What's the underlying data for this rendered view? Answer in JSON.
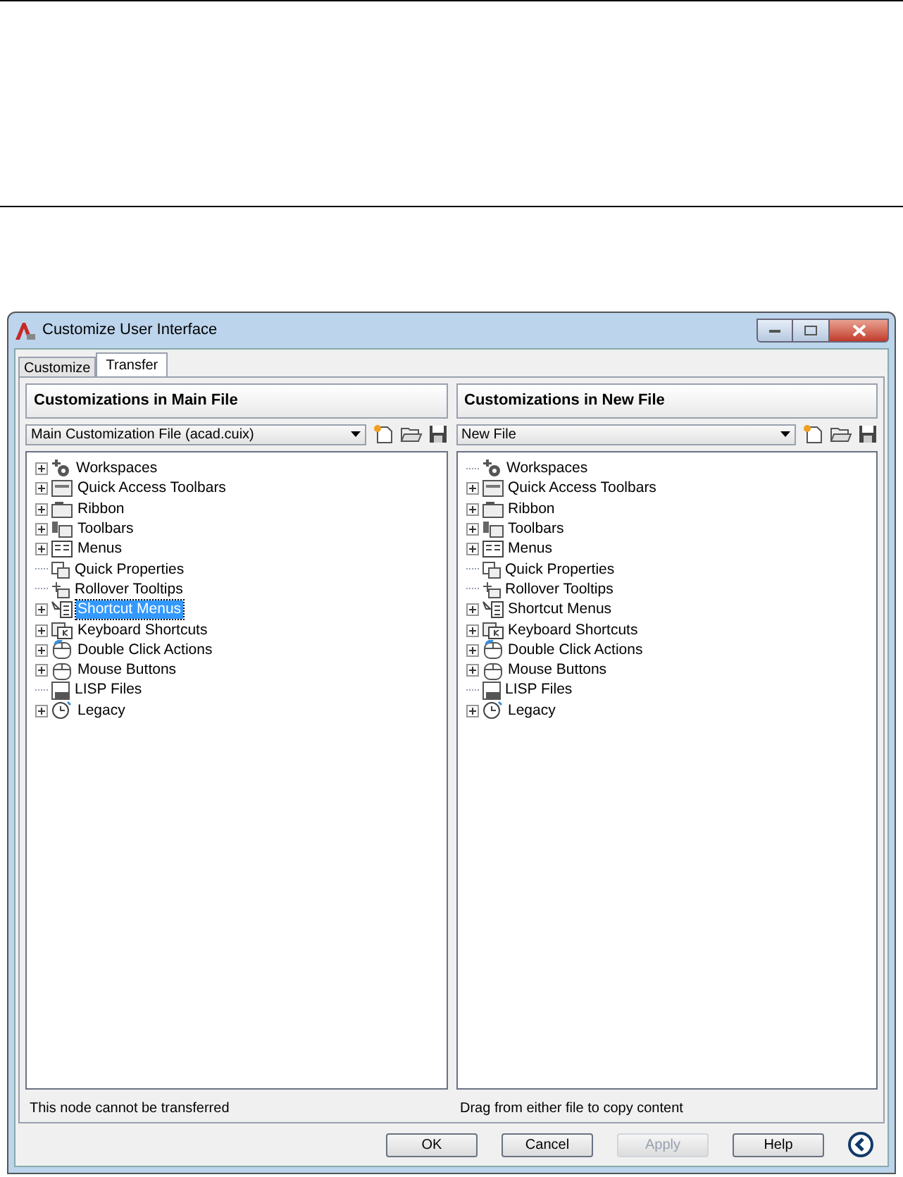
{
  "window": {
    "title": "Customize User Interface"
  },
  "tabs": [
    {
      "label": "Customize",
      "selected": false
    },
    {
      "label": "Transfer",
      "selected": true
    }
  ],
  "panes": [
    {
      "heading": "Customizations in Main File",
      "file": "Main Customization File (acad.cuix)",
      "items": [
        {
          "label": "Workspaces",
          "expandable": true,
          "selected": false
        },
        {
          "label": "Quick Access Toolbars",
          "expandable": true,
          "selected": false
        },
        {
          "label": "Ribbon",
          "expandable": true,
          "selected": false
        },
        {
          "label": "Toolbars",
          "expandable": true,
          "selected": false
        },
        {
          "label": "Menus",
          "expandable": true,
          "selected": false
        },
        {
          "label": "Quick Properties",
          "expandable": false,
          "selected": false
        },
        {
          "label": "Rollover Tooltips",
          "expandable": false,
          "selected": false
        },
        {
          "label": "Shortcut Menus",
          "expandable": true,
          "selected": true
        },
        {
          "label": "Keyboard Shortcuts",
          "expandable": true,
          "selected": false
        },
        {
          "label": "Double Click Actions",
          "expandable": true,
          "selected": false
        },
        {
          "label": "Mouse Buttons",
          "expandable": true,
          "selected": false
        },
        {
          "label": "LISP Files",
          "expandable": false,
          "selected": false
        },
        {
          "label": "Legacy",
          "expandable": true,
          "selected": false
        }
      ],
      "status": "This node cannot be transferred"
    },
    {
      "heading": "Customizations in New File",
      "file": "New File",
      "items": [
        {
          "label": "Workspaces",
          "expandable": false,
          "selected": false
        },
        {
          "label": "Quick Access Toolbars",
          "expandable": true,
          "selected": false
        },
        {
          "label": "Ribbon",
          "expandable": true,
          "selected": false
        },
        {
          "label": "Toolbars",
          "expandable": true,
          "selected": false
        },
        {
          "label": "Menus",
          "expandable": true,
          "selected": false
        },
        {
          "label": "Quick Properties",
          "expandable": false,
          "selected": false
        },
        {
          "label": "Rollover Tooltips",
          "expandable": false,
          "selected": false
        },
        {
          "label": "Shortcut Menus",
          "expandable": true,
          "selected": false
        },
        {
          "label": "Keyboard Shortcuts",
          "expandable": true,
          "selected": false
        },
        {
          "label": "Double Click Actions",
          "expandable": true,
          "selected": false
        },
        {
          "label": "Mouse Buttons",
          "expandable": true,
          "selected": false
        },
        {
          "label": "LISP Files",
          "expandable": false,
          "selected": false
        },
        {
          "label": "Legacy",
          "expandable": true,
          "selected": false
        }
      ],
      "status": "Drag from either file to copy content"
    }
  ],
  "buttons": [
    {
      "label": "OK",
      "disabled": false
    },
    {
      "label": "Cancel",
      "disabled": false
    },
    {
      "label": "Apply",
      "disabled": true
    },
    {
      "label": "Help",
      "disabled": false
    }
  ]
}
